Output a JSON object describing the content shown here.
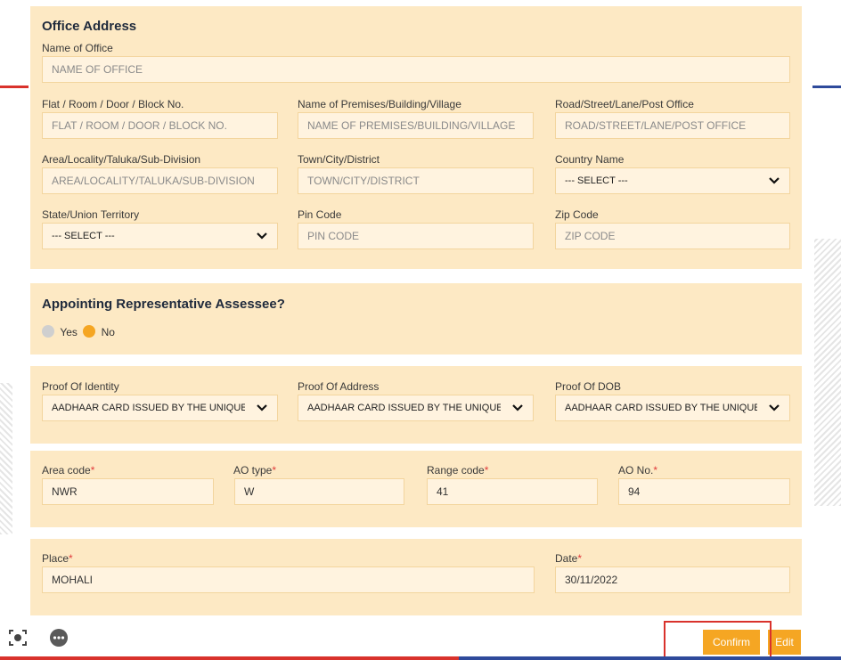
{
  "office_address": {
    "title": "Office Address",
    "name_of_office": {
      "label": "Name of Office",
      "placeholder": "NAME OF OFFICE"
    },
    "flat": {
      "label": "Flat / Room / Door / Block No.",
      "placeholder": "FLAT / ROOM / DOOR / BLOCK NO."
    },
    "premises": {
      "label": "Name of Premises/Building/Village",
      "placeholder": "NAME OF PREMISES/BUILDING/VILLAGE"
    },
    "road": {
      "label": "Road/Street/Lane/Post Office",
      "placeholder": "ROAD/STREET/LANE/POST OFFICE"
    },
    "area": {
      "label": "Area/Locality/Taluka/Sub-Division",
      "placeholder": "AREA/LOCALITY/TALUKA/SUB-DIVISION"
    },
    "town": {
      "label": "Town/City/District",
      "placeholder": "TOWN/CITY/DISTRICT"
    },
    "country": {
      "label": "Country Name",
      "value": "--- SELECT ---"
    },
    "state": {
      "label": "State/Union Territory",
      "value": "--- SELECT ---"
    },
    "pin": {
      "label": "Pin Code",
      "placeholder": "PIN CODE"
    },
    "zip": {
      "label": "Zip Code",
      "placeholder": "ZIP CODE"
    }
  },
  "representative": {
    "title": "Appointing Representative Assessee?",
    "yes_label": "Yes",
    "no_label": "No",
    "selected": "No"
  },
  "proofs": {
    "identity": {
      "label": "Proof Of Identity",
      "value": "AADHAAR CARD ISSUED BY THE UNIQUE IDE"
    },
    "address": {
      "label": "Proof Of Address",
      "value": "AADHAAR CARD ISSUED BY THE UNIQUE IDE"
    },
    "dob": {
      "label": "Proof Of DOB",
      "value": "AADHAAR CARD ISSUED BY THE UNIQUE IDE"
    }
  },
  "ao": {
    "area_code": {
      "label": "Area code",
      "value": "NWR"
    },
    "ao_type": {
      "label": "AO type",
      "value": "W"
    },
    "range_code": {
      "label": "Range code",
      "value": "41"
    },
    "ao_no": {
      "label": "AO No.",
      "value": "94"
    },
    "required_mark": "*"
  },
  "place_date": {
    "place": {
      "label": "Place",
      "value": "MOHALI"
    },
    "date": {
      "label": "Date",
      "value": "30/11/2022"
    },
    "required_mark": "*"
  },
  "actions": {
    "confirm_label": "Confirm",
    "edit_label": "Edit"
  },
  "icons": {
    "screenshot": "screenshot-capture-icon",
    "more": "more-options-icon"
  },
  "colors": {
    "panel": "#fde9c4",
    "field": "#fff3df",
    "accent": "#f5a623",
    "radio_off": "#cfcfcf",
    "required": "#e03b3b",
    "highlight": "#d9322c"
  }
}
